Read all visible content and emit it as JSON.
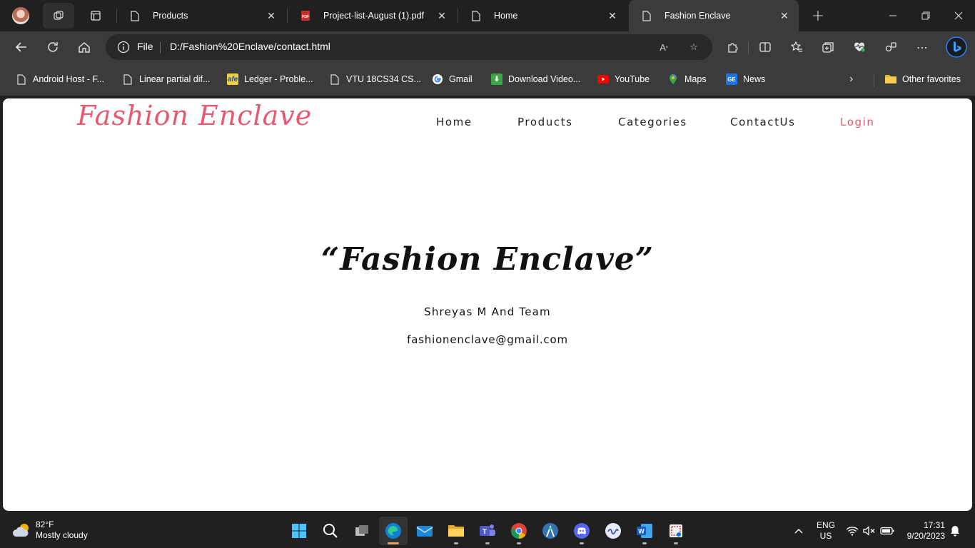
{
  "browser": {
    "tabs": [
      {
        "title": "Products",
        "active": false
      },
      {
        "title": "Project-list-August (1).pdf",
        "active": false
      },
      {
        "title": "Home",
        "active": false
      },
      {
        "title": "Fashion Enclave",
        "active": true
      }
    ],
    "address": {
      "scheme_label": "File",
      "url": "D:/Fashion%20Enclave/contact.html"
    },
    "favorites": [
      {
        "label": "Android Host - F...",
        "icon": "page-icon"
      },
      {
        "label": "Linear partial dif...",
        "icon": "page-icon"
      },
      {
        "label": "Ledger - Proble...",
        "icon": "ledger-icon"
      },
      {
        "label": "VTU 18CS34 CS...",
        "icon": "page-icon"
      },
      {
        "label": "Gmail",
        "icon": "google-icon"
      },
      {
        "label": "Download Video...",
        "icon": "download-icon"
      },
      {
        "label": "YouTube",
        "icon": "youtube-icon"
      },
      {
        "label": "Maps",
        "icon": "maps-icon"
      },
      {
        "label": "News",
        "icon": "news-icon"
      }
    ],
    "other_favorites": "Other favorites"
  },
  "site": {
    "logo": "Fashion Enclave",
    "nav": {
      "home": "Home",
      "products": "Products",
      "categories": "Categories",
      "contact": "ContactUs",
      "login": "Login"
    },
    "contact": {
      "title": "“Fashion Enclave”",
      "team": "Shreyas M And Team",
      "email": "fashionenclave@gmail.com"
    },
    "colors": {
      "accent": "#e8596f",
      "text": "#111111"
    }
  },
  "taskbar": {
    "weather": {
      "temp": "82°F",
      "condition": "Mostly cloudy"
    },
    "language": {
      "lang": "ENG",
      "region": "US"
    },
    "clock": {
      "time": "17:31",
      "date": "9/20/2023"
    }
  }
}
